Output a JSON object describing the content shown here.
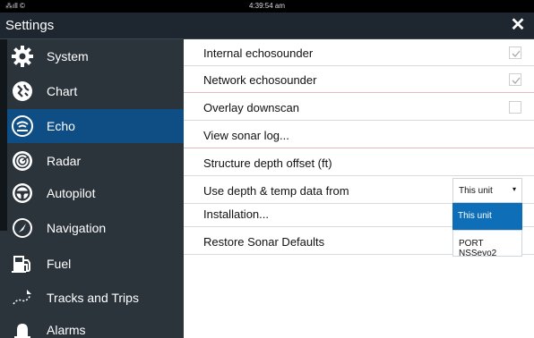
{
  "status": {
    "left": "⁂ıll ©",
    "time": "4:39:54 am"
  },
  "window": {
    "title": "Settings"
  },
  "sidebar": {
    "items": [
      {
        "label": "System",
        "icon": "gear-icon"
      },
      {
        "label": "Chart",
        "icon": "chart-icon"
      },
      {
        "label": "Echo",
        "icon": "echo-icon",
        "active": true
      },
      {
        "label": "Radar",
        "icon": "radar-icon"
      },
      {
        "label": "Autopilot",
        "icon": "steering-wheel-icon"
      },
      {
        "label": "Navigation",
        "icon": "compass-icon"
      },
      {
        "label": "Fuel",
        "icon": "fuel-pump-icon"
      },
      {
        "label": "Tracks and Trips",
        "icon": "track-icon"
      },
      {
        "label": "Alarms",
        "icon": "bell-icon"
      }
    ]
  },
  "main": {
    "rows": [
      {
        "label": "Internal echosounder",
        "checked": true
      },
      {
        "label": "Network echosounder",
        "checked": true
      },
      {
        "label": "Overlay downscan",
        "checked": false
      },
      {
        "label": "View sonar log..."
      },
      {
        "label": "Structure depth offset (ft)"
      },
      {
        "label": "Use depth & temp data from"
      },
      {
        "label": "Installation..."
      },
      {
        "label": "Restore Sonar Defaults"
      }
    ],
    "dropdown": {
      "selected": "This unit",
      "options": [
        "This unit",
        "PORT NSSevo2"
      ]
    }
  },
  "colors": {
    "accent": "#0e4e84",
    "highlight": "#0e6fb8",
    "sidebar_bg": "#2b333b"
  }
}
